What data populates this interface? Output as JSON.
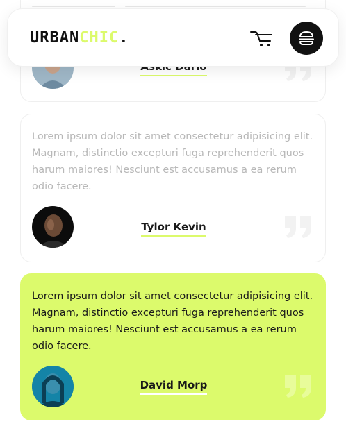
{
  "header": {
    "logo_part1": "URBAN",
    "logo_part2": "CHIC",
    "logo_dot": ".",
    "cart_icon": "cart-icon",
    "menu_icon": "burger-menu-icon"
  },
  "testimonials": [
    {
      "author": "Askic Dario",
      "text": "",
      "avatar": "avatar-photo"
    },
    {
      "author": "Tylor Kevin",
      "text": "Lorem ipsum dolor sit amet consectetur adipisicing elit. Magnam, distinctio excepturi fuga reprehenderit quos harum maiores! Nesciunt est accusamus a ea rerum odio facere.",
      "avatar": "avatar-photo"
    },
    {
      "author": "David Morp",
      "text": "Lorem ipsum dolor sit amet consectetur adipisicing elit. Magnam, distinctio excepturi fuga reprehenderit quos harum maiores! Nesciunt est accusamus a ea rerum odio facere.",
      "avatar": "avatar-photo"
    }
  ],
  "colors": {
    "accent": "#dcfa6c",
    "dark": "#111111",
    "muted_text": "#b8b8b8"
  }
}
